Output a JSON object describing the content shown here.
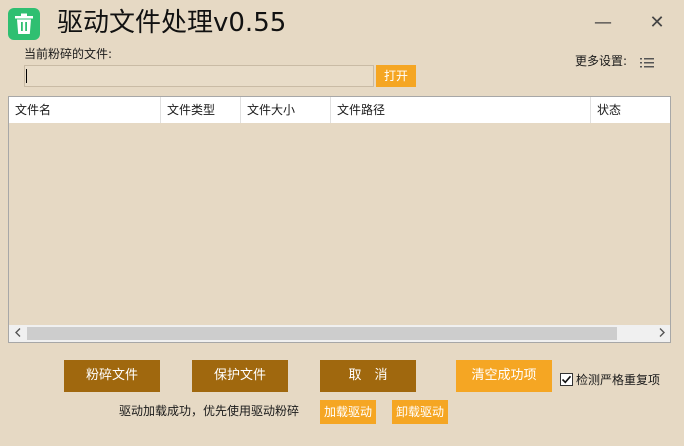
{
  "window": {
    "title": "驱动文件处理v0.55",
    "minimize_glyph": "—",
    "close_glyph": "✕",
    "icon": "trash-icon",
    "accent_color": "#2fbf71"
  },
  "file_section": {
    "label": "当前粉碎的文件:",
    "input_value": "",
    "open_button": "打开"
  },
  "settings": {
    "label": "更多设置:",
    "icon": "menu-list-icon"
  },
  "table": {
    "columns": [
      "文件名",
      "文件类型",
      "文件大小",
      "文件路径",
      "状态"
    ],
    "rows": []
  },
  "actions": {
    "shred": "粉碎文件",
    "protect": "保护文件",
    "cancel": "取　消",
    "clear_success": "清空成功项",
    "strict_check_label": "检测严格重复项",
    "strict_check_checked": true
  },
  "driver": {
    "status_text": "驱动加载成功，优先使用驱动粉碎",
    "load_button": "加载驱动",
    "unload_button": "卸载驱动"
  },
  "colors": {
    "background": "#e6d9c4",
    "orange": "#f5a623",
    "brown": "#a0680e"
  }
}
